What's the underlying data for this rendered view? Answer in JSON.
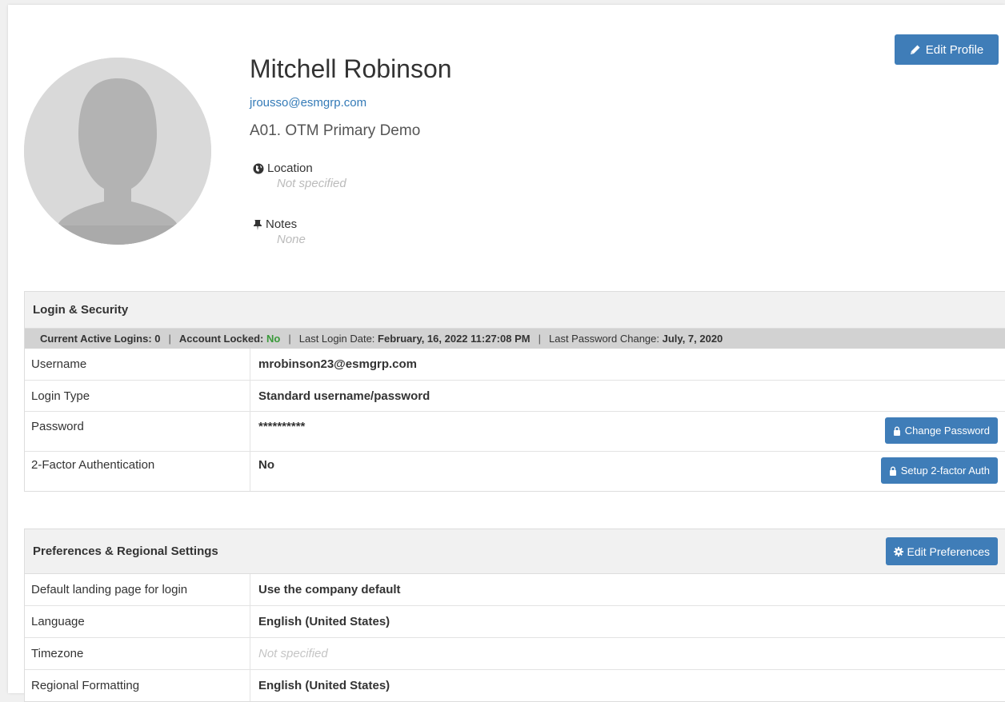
{
  "profile": {
    "name": "Mitchell Robinson",
    "email": "jrousso@esmgrp.com",
    "company": "A01. OTM Primary Demo",
    "edit_label": "Edit Profile",
    "location_label": "Location",
    "location_value": "Not specified",
    "notes_label": "Notes",
    "notes_value": "None"
  },
  "security": {
    "title": "Login & Security",
    "status": {
      "active_logins_label": "Current Active Logins:",
      "active_logins_value": "0",
      "locked_label": "Account Locked:",
      "locked_value": "No",
      "last_login_label": "Last Login Date:",
      "last_login_value": "February, 16, 2022 11:27:08 PM",
      "last_pw_label": "Last Password Change:",
      "last_pw_value": "July, 7, 2020",
      "separator": "|"
    },
    "rows": [
      {
        "label": "Username",
        "value": "mrobinson23@esmgrp.com"
      },
      {
        "label": "Login Type",
        "value": "Standard username/password"
      },
      {
        "label": "Password",
        "value": "**********",
        "button": "Change Password"
      },
      {
        "label": "2-Factor Authentication",
        "value": "No",
        "button": "Setup 2-factor Auth"
      }
    ]
  },
  "preferences": {
    "title": "Preferences & Regional Settings",
    "edit_label": "Edit Preferences",
    "rows": [
      {
        "label": "Default landing page for login",
        "value": "Use the company default"
      },
      {
        "label": "Language",
        "value": "English (United States)"
      },
      {
        "label": "Timezone",
        "value": "Not specified"
      },
      {
        "label": "Regional Formatting",
        "value": "English (United States)"
      }
    ]
  },
  "colors": {
    "primary_button": "#3f7db8",
    "link": "#337ab7",
    "status_green": "#3a9a3a"
  },
  "icons": [
    "pencil-icon",
    "globe-icon",
    "pin-icon",
    "lock-icon",
    "gear-icon"
  ]
}
